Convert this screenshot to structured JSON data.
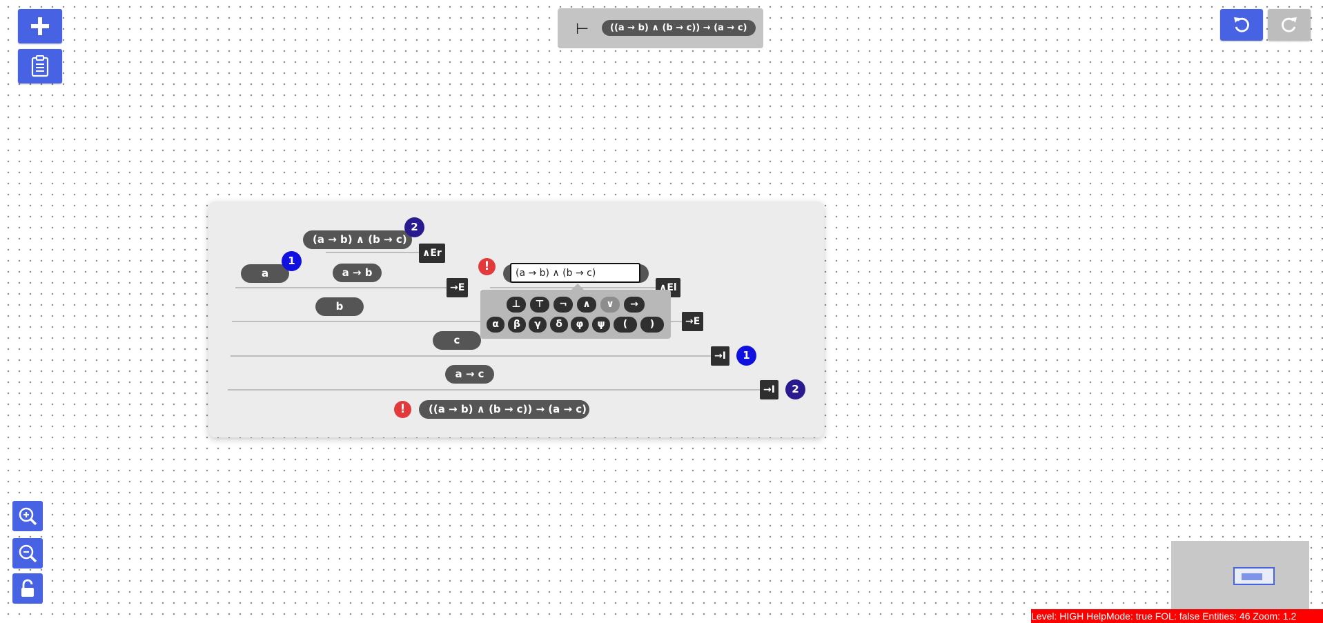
{
  "toolbar": {
    "add_icon": "plus-icon",
    "notes_icon": "clipboard-icon",
    "undo_icon": "undo-icon",
    "redo_icon": "redo-icon"
  },
  "goal": {
    "turnstile": "⊢",
    "formula": "((a → b) ∧ (b → c)) → (a → c)"
  },
  "proof": {
    "nodes": {
      "premise_and": "(a → b) ∧ (b → c)",
      "a": "a",
      "a_imp_b": "a → b",
      "b": "b",
      "c": "c",
      "a_imp_c": "a → c",
      "conclusion": "((a → b) ∧ (b → c)) → (a → c)"
    },
    "editing_value": "(a → b) ∧ (b → c)",
    "rules": {
      "and_er": "∧Er",
      "imp_e_1": "→E",
      "and_el": "∧El",
      "imp_e_2": "→E",
      "imp_i_1": "→I",
      "imp_i_2": "→I"
    },
    "badges": {
      "assumption_1": "1",
      "assumption_2": "2",
      "discharge_1": "1",
      "discharge_2": "2"
    },
    "warning_symbol": "!"
  },
  "symbols": {
    "row1": [
      "⊥",
      "⊤",
      "¬",
      "∧",
      "∨",
      "→"
    ],
    "row2": [
      "α",
      "β",
      "γ",
      "δ",
      "φ",
      "ψ",
      "(",
      ")"
    ]
  },
  "zoom": {
    "in_icon": "zoom-in-icon",
    "out_icon": "zoom-out-icon",
    "lock_icon": "unlock-icon"
  },
  "status_bar": "Level: HIGH HelpMode: true FOL: false Entities: 46 Zoom: 1.2",
  "colors": {
    "accent": "#4763e4",
    "pill": "#555555",
    "rule": "#2f2f2f",
    "badge_light": "#1010e0",
    "badge_dark": "#2a1a8f",
    "warning": "#e23a3a",
    "status_bg": "#ff0000"
  }
}
